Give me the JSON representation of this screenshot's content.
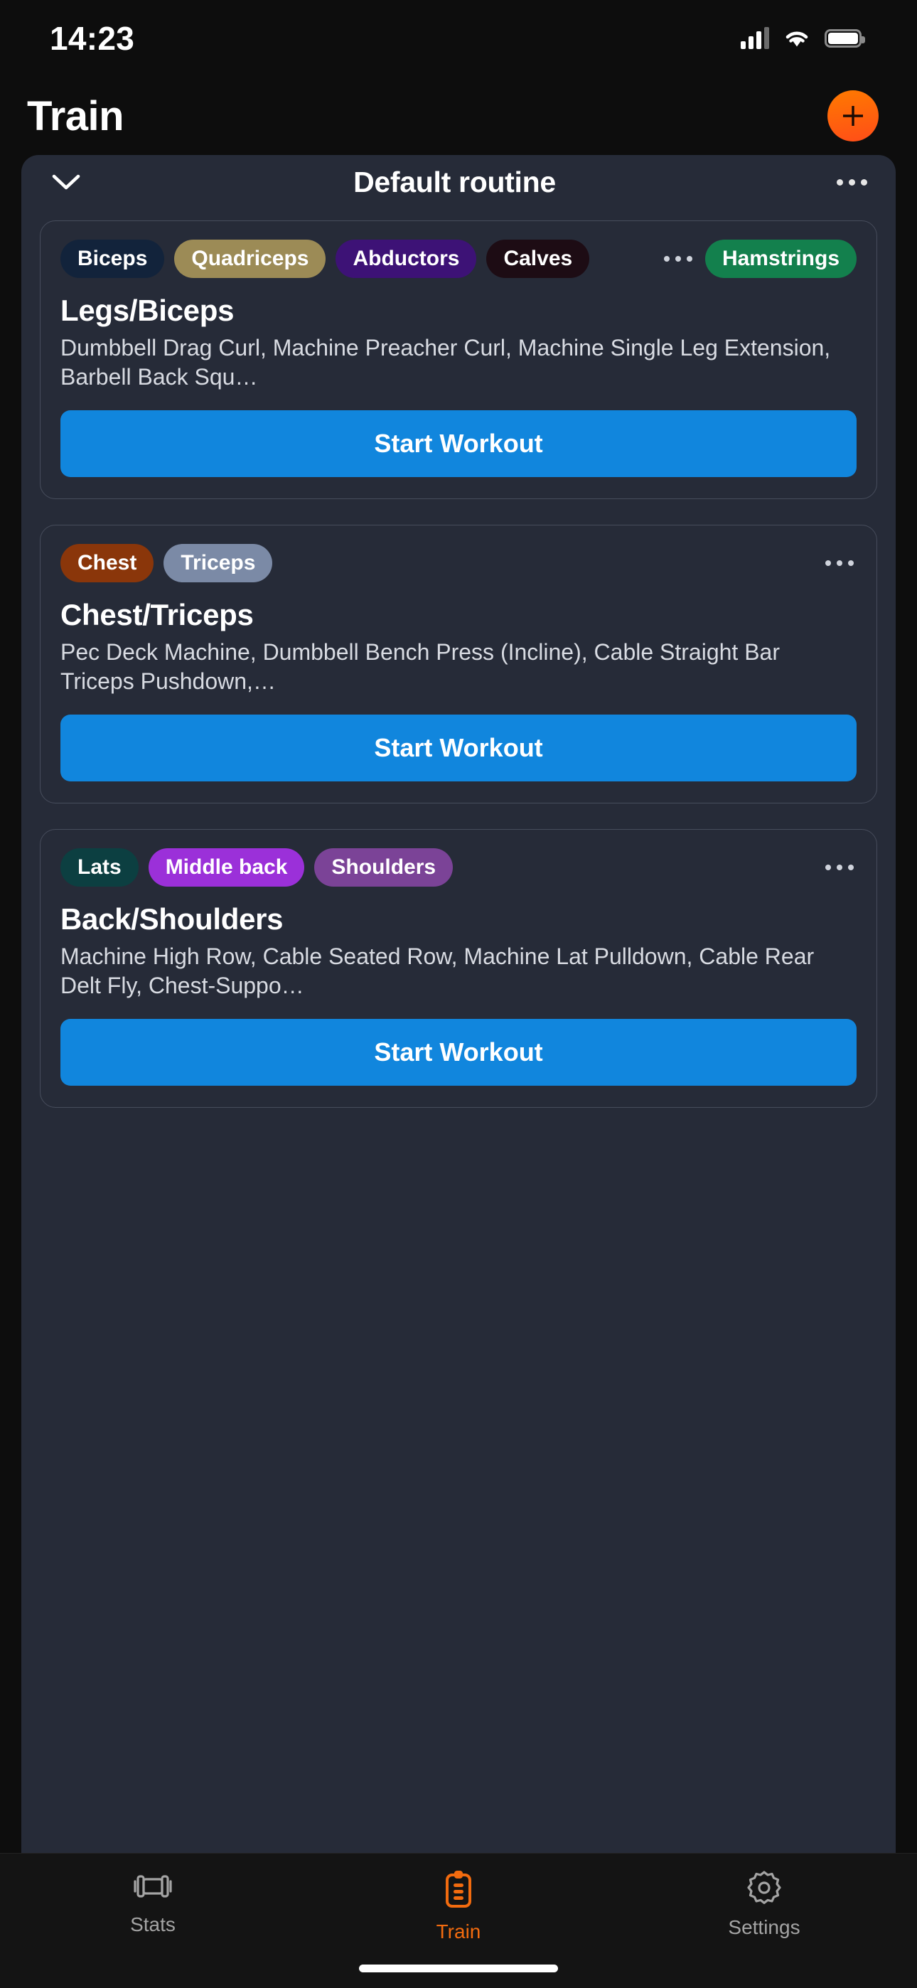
{
  "status_bar": {
    "time": "14:23",
    "icons": [
      "cellular-signal-icon",
      "wifi-icon",
      "battery-icon"
    ]
  },
  "header": {
    "title": "Train",
    "add_button": {
      "name": "add-button",
      "glyph": "+",
      "color": "#ff5a1f"
    }
  },
  "routine": {
    "title": "Default routine",
    "collapse_icon": "chevron-down-icon",
    "menu_icon": "ellipsis-icon"
  },
  "workouts": [
    {
      "title": "Legs/Biceps",
      "exercises": "Dumbbell Drag Curl, Machine Preacher Curl, Machine Single Leg Extension, Barbell Back Squ…",
      "start_label": "Start Workout",
      "tags": [
        {
          "label": "Biceps",
          "color": "#12233b"
        },
        {
          "label": "Quadriceps",
          "color": "#9c8b56"
        },
        {
          "label": "Abductors",
          "color": "#3d1276"
        },
        {
          "label": "Calves",
          "color": "#1d0c14"
        },
        {
          "label": "Hamstrings",
          "color": "#13804d"
        }
      ]
    },
    {
      "title": "Chest/Triceps",
      "exercises": "Pec Deck Machine, Dumbbell Bench Press (Incline), Cable Straight Bar Triceps Pushdown,…",
      "start_label": "Start Workout",
      "tags": [
        {
          "label": "Chest",
          "color": "#8a360a"
        },
        {
          "label": "Triceps",
          "color": "#7b8aa6"
        }
      ]
    },
    {
      "title": "Back/Shoulders",
      "exercises": "Machine High Row, Cable Seated Row, Machine Lat Pulldown, Cable Rear Delt Fly, Chest-Suppo…",
      "start_label": "Start Workout",
      "tags": [
        {
          "label": "Lats",
          "color": "#0c3f41"
        },
        {
          "label": "Middle back",
          "color": "#9b30d9"
        },
        {
          "label": "Shoulders",
          "color": "#7b4397"
        }
      ]
    }
  ],
  "tabbar": {
    "items": [
      {
        "label": "Stats",
        "icon": "dumbbell-icon",
        "active": false
      },
      {
        "label": "Train",
        "icon": "clipboard-icon",
        "active": true
      },
      {
        "label": "Settings",
        "icon": "gear-icon",
        "active": false
      }
    ],
    "active_color": "#f26b0f",
    "inactive_color": "#a4a4a4"
  },
  "theme": {
    "accent": "#ff5a1f",
    "primary_button": "#1186dd",
    "sheet_bg": "#262b38",
    "app_bg": "#0d0d0d"
  }
}
